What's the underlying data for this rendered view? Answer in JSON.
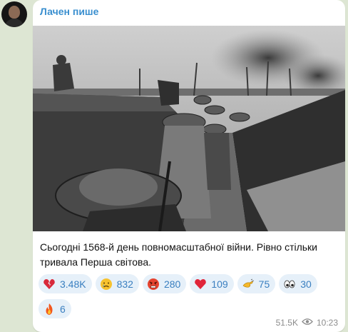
{
  "post": {
    "channel_name": "Лачен пише",
    "text": "Сьогодні 1568-й день повномасштабної війни. Рівно стільки тривала Перша світова.",
    "views": "51.5K",
    "time": "10:23",
    "photo_icon": "trench-photo"
  },
  "reactions": [
    {
      "icon": "broken-heart-icon",
      "count": "3.48K"
    },
    {
      "icon": "crying-face-icon",
      "count": "832"
    },
    {
      "icon": "angry-face-icon",
      "count": "280"
    },
    {
      "icon": "red-heart-icon",
      "count": "109"
    },
    {
      "icon": "clapping-hand-icon",
      "count": "75"
    },
    {
      "icon": "eyes-icon",
      "count": "30"
    },
    {
      "icon": "fire-icon",
      "count": "6"
    }
  ],
  "colors": {
    "background": "#dde6d3",
    "accent": "#3a8fcf",
    "chip_bg": "#e6f0f9",
    "chip_text": "#3a7fc0"
  }
}
